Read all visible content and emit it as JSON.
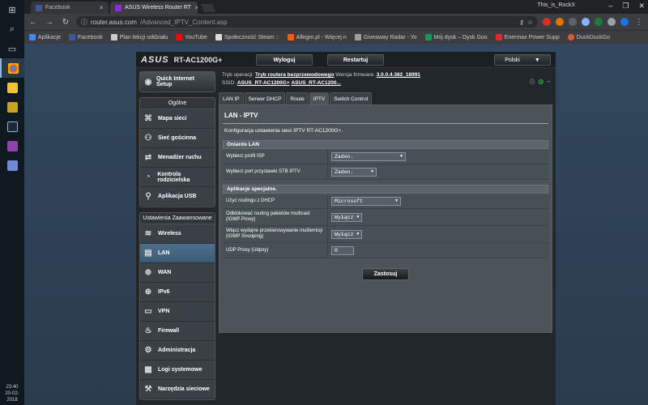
{
  "browser": {
    "tabs": [
      {
        "label": "Facebook",
        "color": "#3b5998"
      },
      {
        "label": "ASUS Wireless Router RT",
        "color": "#8a2be2"
      }
    ],
    "user": "This_is_RockX",
    "url_host": "router.asus.com",
    "url_path": "/Advanced_IPTV_Content.asp",
    "bookmarks": [
      "Aplikacje",
      "Facebook",
      "Plan lekcji oddziału",
      "YouTube",
      "Społeczność Steam ::",
      "Allegro.pl - Więcej n",
      "Giveaway Radar - Yo",
      "Mój dysk – Dysk Goo",
      "Enermax Power Supp",
      "DuckDuckGo"
    ]
  },
  "taskbar": {
    "time": "23:40",
    "date": "20-02-2018"
  },
  "router": {
    "logo": "ASUS",
    "model": "RT-AC1200G+",
    "logout": "Wyloguj",
    "restart": "Restartuj",
    "language": "Polski",
    "status": {
      "mode_label": "Tryb operacji:",
      "mode_value": "Tryb routera bezprzewodowego",
      "fw_label": "Wersja firmware:",
      "fw_value": "3.0.0.4.382_18991",
      "ssid_label": "SSID:",
      "ssid1": "ASUS_RT-AC1200G+",
      "ssid2": "ASUS_RT-AC1200..."
    },
    "sidebar": {
      "qis": "Quick Internet Setup",
      "general_title": "Ogólne",
      "general": [
        "Mapa sieci",
        "Sieć gościnna",
        "Menadżer ruchu",
        "Kontrola rodzicielska",
        "Aplikacja USB"
      ],
      "advanced_title": "Ustawienia Zaawansowane",
      "advanced": [
        "Wireless",
        "LAN",
        "WAN",
        "IPv6",
        "VPN",
        "Firewall",
        "Administracja",
        "Logi systemowe",
        "Narzędzia sieciowe"
      ]
    },
    "tabs": [
      "LAN IP",
      "Serwer DHCP",
      "Route",
      "IPTV",
      "Switch Control"
    ],
    "page_title": "LAN - IPTV",
    "description": "Konfiguracja ustawienia sieci IPTV RT-AC1200G+.",
    "lan_section": {
      "title": "Oniardo LAN",
      "rows": [
        {
          "label": "Wybierz profil ISP",
          "value": "Zaden."
        },
        {
          "label": "Wybierz port przystawki STB IPTV",
          "value": "Zaden."
        }
      ]
    },
    "special_section": {
      "title": "Aplikacje specjalne.",
      "rows": [
        {
          "label": "Użyć routingu z DHCP",
          "value": "Microsoft"
        },
        {
          "label": "Odblokować routing pakietów multicast (IGMP Proxy)",
          "value": "Wyłącz"
        },
        {
          "label": "Włącz wydajne przekierowywanie multiemisji (IGMP Snooping)",
          "value": "Wyłącz"
        },
        {
          "label": "UDP Proxy (Udpxy)",
          "value": "0"
        }
      ]
    },
    "apply": "Zastosuj"
  }
}
